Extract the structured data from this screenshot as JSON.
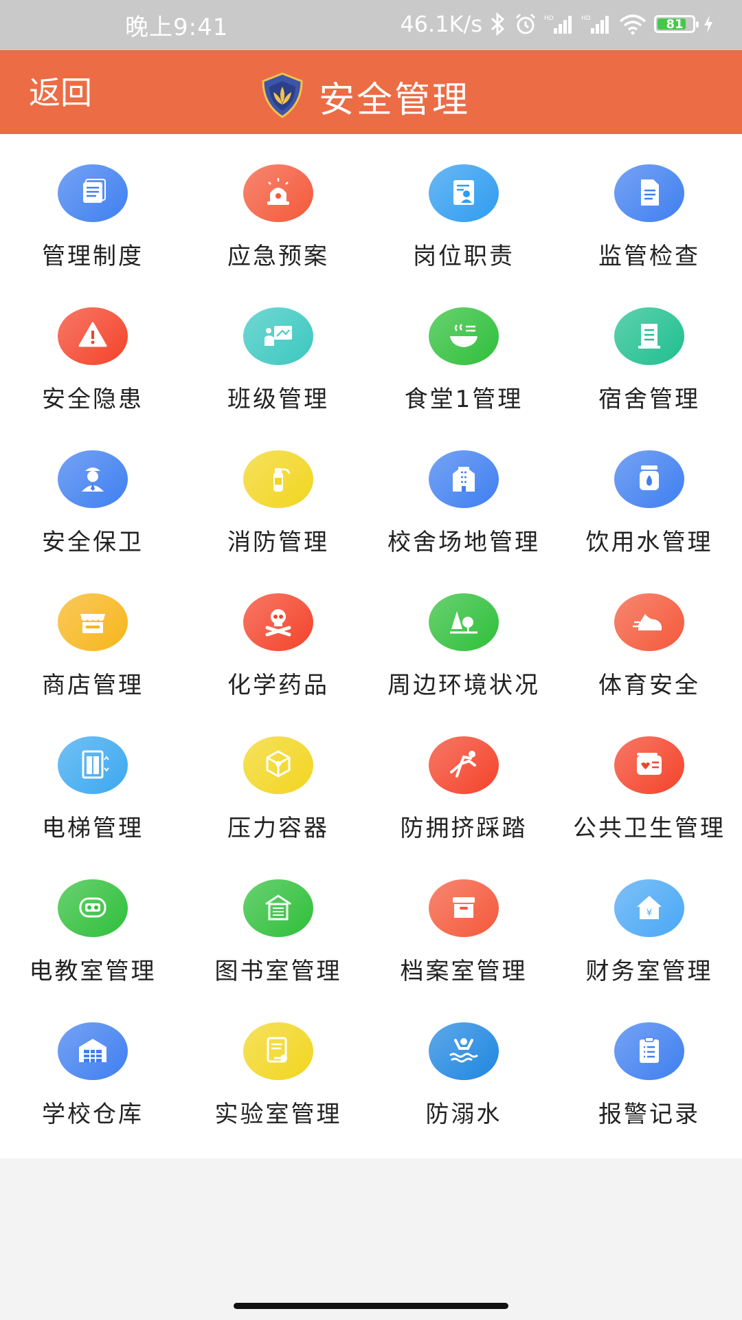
{
  "status_bar": {
    "time": "晚上9:41",
    "network_speed": "46.1K/s",
    "battery_level": "81",
    "battery_fraction": 0.81,
    "icons": [
      "bluetooth-icon",
      "alarm-icon",
      "signal-hd-icon",
      "signal-hd-icon",
      "wifi-icon",
      "battery-icon",
      "charging-icon"
    ]
  },
  "header": {
    "back_label": "返回",
    "title": "安全管理",
    "accent_color": "#ec6c45"
  },
  "tiles": [
    {
      "label": "管理制度",
      "icon": "document-list-icon",
      "color": "#3f7ff0"
    },
    {
      "label": "应急预案",
      "icon": "alarm-light-icon",
      "color": "#f4593a"
    },
    {
      "label": "岗位职责",
      "icon": "id-card-icon",
      "color": "#2f9cf0"
    },
    {
      "label": "监管检查",
      "icon": "checklist-icon",
      "color": "#3f7ff0"
    },
    {
      "label": "安全隐患",
      "icon": "warning-icon",
      "color": "#f4432a"
    },
    {
      "label": "班级管理",
      "icon": "classroom-icon",
      "color": "#3bc8c0"
    },
    {
      "label": "食堂1管理",
      "icon": "bowl-icon",
      "color": "#2fbf3a"
    },
    {
      "label": "宿舍管理",
      "icon": "dormitory-icon",
      "color": "#1fbf8f"
    },
    {
      "label": "安全保卫",
      "icon": "security-guard-icon",
      "color": "#3f7ff0"
    },
    {
      "label": "消防管理",
      "icon": "fire-extinguisher-icon",
      "color": "#f2d51f"
    },
    {
      "label": "校舍场地管理",
      "icon": "building-icon",
      "color": "#3f7ff0"
    },
    {
      "label": "饮用水管理",
      "icon": "water-bottle-icon",
      "color": "#3f7ff0"
    },
    {
      "label": "商店管理",
      "icon": "shop-icon",
      "color": "#f6b51b"
    },
    {
      "label": "化学药品",
      "icon": "skull-icon",
      "color": "#f4432a"
    },
    {
      "label": "周边环境状况",
      "icon": "tree-icon",
      "color": "#2fbf3a"
    },
    {
      "label": "体育安全",
      "icon": "sneaker-icon",
      "color": "#f4593a"
    },
    {
      "label": "电梯管理",
      "icon": "elevator-icon",
      "color": "#3ba8f0"
    },
    {
      "label": "压力容器",
      "icon": "cube-icon",
      "color": "#f2d51f"
    },
    {
      "label": "防拥挤踩踏",
      "icon": "person-falling-icon",
      "color": "#f4432a"
    },
    {
      "label": "公共卫生管理",
      "icon": "health-card-icon",
      "color": "#f4432a"
    },
    {
      "label": "电教室管理",
      "icon": "projector-icon",
      "color": "#2fbf3a"
    },
    {
      "label": "图书室管理",
      "icon": "library-icon",
      "color": "#2fbf3a"
    },
    {
      "label": "档案室管理",
      "icon": "archive-box-icon",
      "color": "#f4593a"
    },
    {
      "label": "财务室管理",
      "icon": "finance-house-icon",
      "color": "#4aa8f5"
    },
    {
      "label": "学校仓库",
      "icon": "warehouse-icon",
      "color": "#3f7ff0"
    },
    {
      "label": "实验室管理",
      "icon": "lab-report-icon",
      "color": "#f2d51f"
    },
    {
      "label": "防溺水",
      "icon": "drowning-icon",
      "color": "#1f86e0"
    },
    {
      "label": "报警记录",
      "icon": "clipboard-icon",
      "color": "#3f7ff0"
    }
  ]
}
